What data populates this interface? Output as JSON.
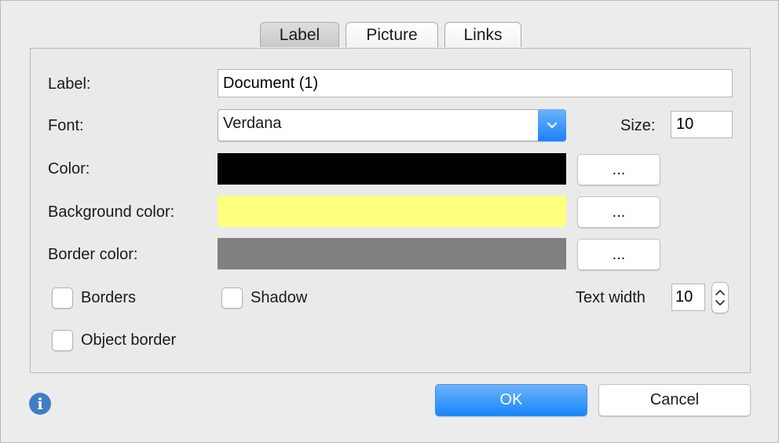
{
  "tabs": [
    {
      "label": "Label",
      "active": true
    },
    {
      "label": "Picture",
      "active": false
    },
    {
      "label": "Links",
      "active": false
    }
  ],
  "form": {
    "label_caption": "Label:",
    "label_value": "Document (1)",
    "font_caption": "Font:",
    "font_value": "Verdana",
    "size_caption": "Size:",
    "size_value": "10",
    "color_caption": "Color:",
    "color_value": "#000000",
    "bg_color_caption": "Background color:",
    "bg_color_value": "#ffff80",
    "border_color_caption": "Border color:",
    "border_color_value": "#808080",
    "picker_label": "...",
    "borders_label": "Borders",
    "borders_checked": false,
    "shadow_label": "Shadow",
    "shadow_checked": false,
    "object_border_label": "Object border",
    "object_border_checked": false,
    "text_width_caption": "Text width",
    "text_width_value": "10"
  },
  "footer": {
    "ok_label": "OK",
    "cancel_label": "Cancel",
    "info_icon": "info-icon"
  },
  "colors": {
    "accent": "#1a82fb",
    "info": "#3f7ec3"
  }
}
